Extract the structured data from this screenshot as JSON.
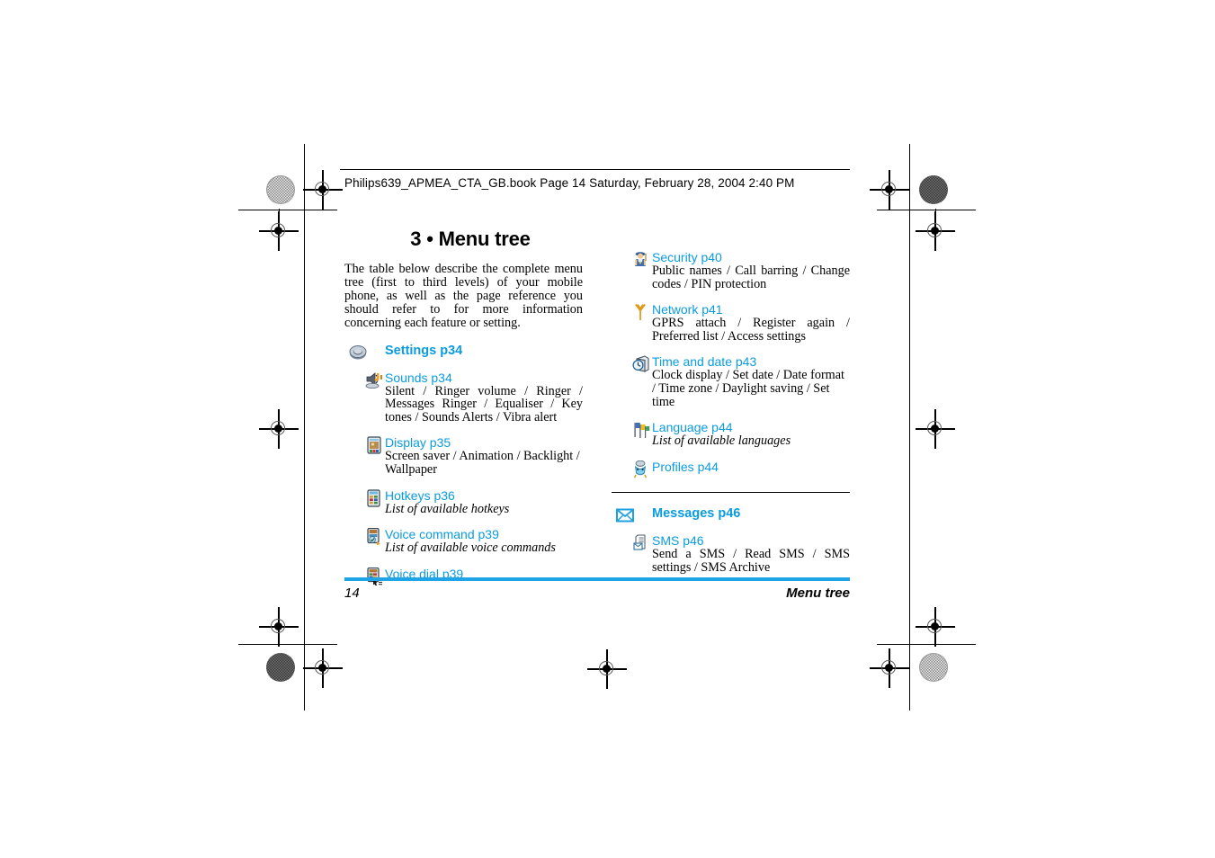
{
  "print_header": {
    "text": "Philips639_APMEA_CTA_GB.book  Page 14  Saturday, February 28, 2004  2:40 PM"
  },
  "doc": {
    "title": "3 • Menu tree",
    "intro": "The table below describe the complete menu tree (first to third levels) of your mobile phone, as well as the page reference you should refer to for more information concerning each feature or setting."
  },
  "colors": {
    "accent_blue": "#0A9BE0",
    "footer_bar": "#1FA4E8",
    "text": "#000000"
  },
  "left_column": {
    "sections": [
      {
        "level": 1,
        "icon": "nut-icon",
        "title": "Settings p34"
      },
      {
        "level": 2,
        "icon": "speaker-icon",
        "title": "Sounds p34",
        "desc": "Silent / Ringer volume / Ringer / Messages Ringer / Equaliser / Key tones / Sounds Alerts / Vibra alert",
        "italic": false
      },
      {
        "level": 2,
        "icon": "display-icon",
        "title": "Display p35",
        "desc": "Screen saver / Animation / Backlight / Wallpaper",
        "italic": false
      },
      {
        "level": 2,
        "icon": "hotkeys-icon",
        "title": "Hotkeys p36",
        "desc": "List of available hotkeys",
        "italic": true
      },
      {
        "level": 2,
        "icon": "voice-command-icon",
        "title": "Voice command p39",
        "desc": "List of available voice commands",
        "italic": true
      },
      {
        "level": 2,
        "icon": "voice-dial-icon",
        "title": "Voice dial p39",
        "desc": "",
        "italic": false
      }
    ]
  },
  "right_column": {
    "sections": [
      {
        "level": 2,
        "icon": "security-guard-icon",
        "title": "Security p40",
        "desc": "Public names / Call barring / Change codes / PIN protection",
        "italic": false
      },
      {
        "level": 2,
        "icon": "antenna-icon",
        "title": "Network p41",
        "desc": "GPRS attach / Register again / Preferred list / Access settings",
        "italic": false
      },
      {
        "level": 2,
        "icon": "clock-icon",
        "title": "Time and date p43",
        "desc": "Clock display / Set date / Date format / Time zone / Daylight saving / Set time",
        "italic": false
      },
      {
        "level": 2,
        "icon": "flags-icon",
        "title": "Language p44",
        "desc": "List of available languages",
        "italic": true
      },
      {
        "level": 2,
        "icon": "profiles-icon",
        "title": "Profiles p44",
        "desc": "",
        "italic": false
      }
    ],
    "messages_section": {
      "level": 1,
      "icon": "envelope-icon",
      "title": "Messages p46"
    },
    "messages_children": [
      {
        "level": 2,
        "icon": "sms-icon",
        "title": "SMS p46",
        "desc": "Send a SMS / Read SMS / SMS settings / SMS Archive",
        "italic": false
      }
    ]
  },
  "footer": {
    "page_number": "14",
    "chapter": "Menu tree"
  }
}
